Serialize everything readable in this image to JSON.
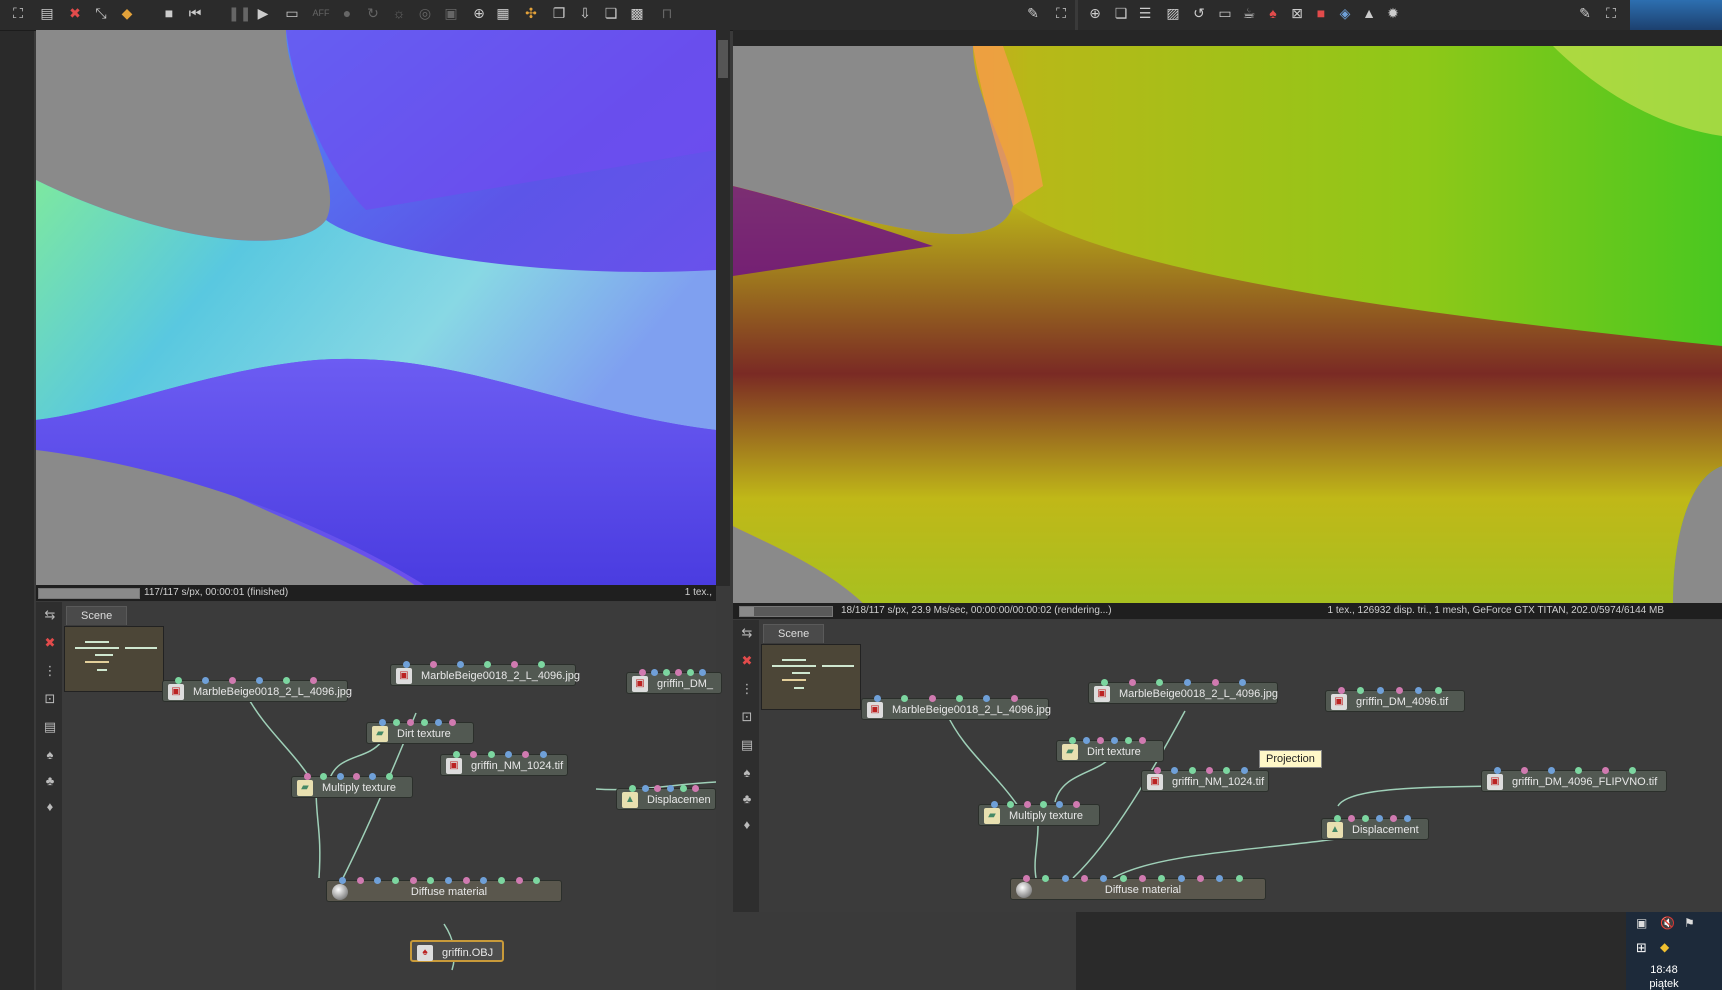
{
  "left_window": {
    "toolbar_icons": [
      "fullscreen-icon",
      "save-icon",
      "clear-icon",
      "transform-icon",
      "cube-icon",
      "stop-icon",
      "rewind-icon",
      "pause-icon",
      "play-icon",
      "screen-icon",
      "aff-icon",
      "sphere-icon",
      "rotate-icon",
      "light-icon",
      "camera-icon",
      "frame-icon",
      "zoom-icon",
      "region-icon",
      "picker-icon",
      "copy-icon",
      "export-icon",
      "layers-icon",
      "checker-icon",
      "lock-icon",
      "wrench-icon",
      "expand-icon"
    ],
    "status": {
      "progress": 1.0,
      "text": "117/117 s/px, 00:00:01 (finished)",
      "right": "1 tex.,"
    },
    "graph": {
      "tab": "Scene",
      "nodes": {
        "marble1": "MarbleBeige0018_2_L_4096.jpg",
        "marble2": "MarbleBeige0018_2_L_4096.jpg",
        "griffin_dm": "griffin_DM_",
        "dirt": "Dirt texture",
        "griffin_nm": "griffin_NM_1024.tif",
        "multiply": "Multiply texture",
        "displacement": "Displacemen",
        "diffuse": "Diffuse material",
        "obj": "griffin.OBJ"
      }
    }
  },
  "right_window": {
    "status": {
      "progress": 0.15,
      "text": "18/18/117 s/px, 23.9 Ms/sec, 00:00:00/00:00:02 (rendering...)",
      "right": "1 tex., 126932 disp. tri., 1 mesh, GeForce GTX TITAN, 202.0/5974/6144 MB"
    },
    "graph": {
      "tab": "Scene",
      "tooltip": "Projection",
      "nodes": {
        "marble1": "MarbleBeige0018_2_L_4096.jpg",
        "marble2": "MarbleBeige0018_2_L_4096.jpg",
        "griffin_dm": "griffin_DM_4096.tif",
        "dirt": "Dirt texture",
        "griffin_nm": "griffin_NM_1024.tif",
        "flip": "griffin_DM_4096_FLIPVNO.tif",
        "multiply": "Multiply texture",
        "displacement": "Displacement",
        "diffuse": "Diffuse material"
      }
    }
  },
  "taskbar": {
    "time": "18:48",
    "day": "piątek"
  },
  "colors": {
    "node": "#525952",
    "material_node": "#5a574d",
    "wire": "#9fd0b8",
    "selected": "#c89a3a",
    "pin_blue": "#6fa0d8",
    "pin_pink": "#d07ab0",
    "pin_green": "#7cd6a0"
  }
}
